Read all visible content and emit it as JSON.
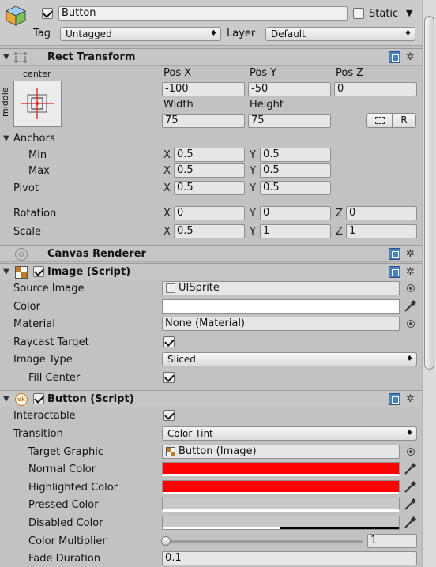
{
  "header": {
    "object_active": true,
    "name": "Button",
    "static_label": "Static",
    "static_checked": false,
    "tag_label": "Tag",
    "tag_value": "Untagged",
    "layer_label": "Layer",
    "layer_value": "Default"
  },
  "rect_transform": {
    "title": "Rect Transform",
    "anchor_preset_h": "center",
    "anchor_preset_v": "middle",
    "pos_x_label": "Pos X",
    "pos_x": "-100",
    "pos_y_label": "Pos Y",
    "pos_y": "-50",
    "pos_z_label": "Pos Z",
    "pos_z": "0",
    "width_label": "Width",
    "width": "75",
    "height_label": "Height",
    "height": "75",
    "raw_button": "R",
    "anchors_label": "Anchors",
    "min_label": "Min",
    "min_x": "0.5",
    "min_y": "0.5",
    "max_label": "Max",
    "max_x": "0.5",
    "max_y": "0.5",
    "pivot_label": "Pivot",
    "pivot_x": "0.5",
    "pivot_y": "0.5",
    "rotation_label": "Rotation",
    "rot_x": "0",
    "rot_y": "0",
    "rot_z": "0",
    "scale_label": "Scale",
    "scale_x": "0.5",
    "scale_y": "1",
    "scale_z": "1",
    "axis_x": "X",
    "axis_y": "Y",
    "axis_z": "Z"
  },
  "canvas_renderer": {
    "title": "Canvas Renderer"
  },
  "image": {
    "title": "Image (Script)",
    "enabled": true,
    "source_image_label": "Source Image",
    "source_image": "UISprite",
    "color_label": "Color",
    "color": "#ffffff",
    "material_label": "Material",
    "material": "None (Material)",
    "raycast_label": "Raycast Target",
    "raycast": true,
    "image_type_label": "Image Type",
    "image_type": "Sliced",
    "fill_center_label": "Fill Center",
    "fill_center": true
  },
  "button": {
    "title": "Button (Script)",
    "enabled": true,
    "interactable_label": "Interactable",
    "interactable": true,
    "transition_label": "Transition",
    "transition": "Color Tint",
    "target_graphic_label": "Target Graphic",
    "target_graphic": "Button (Image)",
    "normal_color_label": "Normal Color",
    "normal_color": "#ff0000",
    "highlighted_color_label": "Highlighted Color",
    "highlighted_color": "#ff0000",
    "pressed_color_label": "Pressed Color",
    "pressed_color": "#c8c8c8",
    "disabled_color_label": "Disabled Color",
    "disabled_color": "#c8c8c8",
    "color_multiplier_label": "Color Multiplier",
    "color_multiplier": "1",
    "color_multiplier_fraction": 0.0,
    "fade_duration_label": "Fade Duration",
    "fade_duration": "0.1"
  }
}
